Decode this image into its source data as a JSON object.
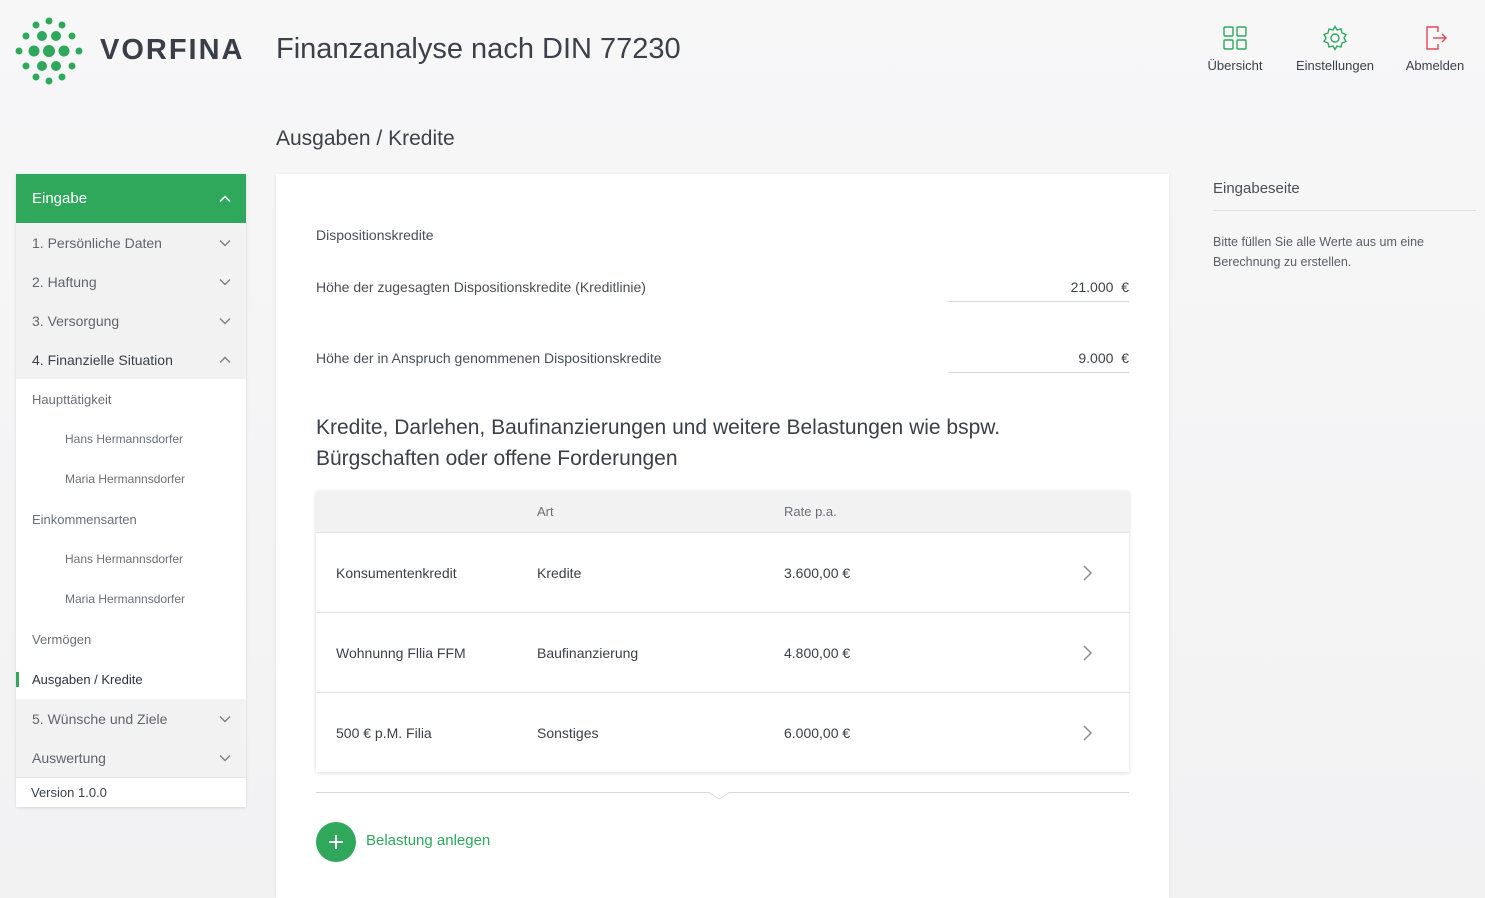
{
  "header": {
    "brand": "VORFINA",
    "app_title": "Finanzanalyse nach DIN 77230",
    "nav": [
      {
        "label": "Übersicht",
        "icon": "grid-icon"
      },
      {
        "label": "Einstellungen",
        "icon": "gear-icon"
      },
      {
        "label": "Abmelden",
        "icon": "logout-icon"
      }
    ]
  },
  "page": {
    "title": "Ausgaben / Kredite"
  },
  "sidebar": {
    "header_label": "Eingabe",
    "sections": [
      {
        "label": "1. Persönliche Daten"
      },
      {
        "label": "2. Haftung"
      },
      {
        "label": "3. Versorgung"
      },
      {
        "label": "4. Finanzielle Situation"
      }
    ],
    "subitems": [
      {
        "label": "Haupttätigkeit"
      },
      {
        "label": "Hans Hermannsdorfer"
      },
      {
        "label": "Maria Hermannsdorfer"
      },
      {
        "label": "Einkommensarten"
      },
      {
        "label": "Hans Hermannsdorfer"
      },
      {
        "label": "Maria Hermannsdorfer"
      },
      {
        "label": "Vermögen"
      },
      {
        "label": "Ausgaben / Kredite"
      }
    ],
    "sections_after": [
      {
        "label": "5. Wünsche und Ziele"
      },
      {
        "label": "Auswertung"
      }
    ],
    "version": "Version 1.0.0"
  },
  "main": {
    "section_label": "Dispositionskredite",
    "fields": [
      {
        "label": "Höhe der zugesagten Dispositionskredite (Kreditlinie)",
        "value": "21.000",
        "unit": "€"
      },
      {
        "label": "Höhe der in Anspruch genommenen Dispositionskredite",
        "value": "9.000",
        "unit": "€"
      }
    ],
    "heading": "Kredite, Darlehen, Baufinanzierungen und weitere Belastungen wie bspw. Bürgschaften oder offene Forderungen",
    "table": {
      "headers": [
        "",
        "Art",
        "Rate p.a."
      ],
      "rows": [
        {
          "name": "Konsumentenkredit",
          "type": "Kredite",
          "rate": "3.600,00 €"
        },
        {
          "name": "Wohnunng Fllia FFM",
          "type": "Baufinanzierung",
          "rate": "4.800,00 €"
        },
        {
          "name": "500 € p.M. Filia",
          "type": "Sonstiges",
          "rate": "6.000,00 €"
        }
      ]
    },
    "add_label": "Belastung anlegen"
  },
  "info_panel": {
    "title": "Eingabeseite",
    "text": "Bitte füllen Sie alle Werte aus um eine Berechnung zu erstellen."
  },
  "colors": {
    "accent": "#2fa85c",
    "logout": "#e0485a"
  }
}
